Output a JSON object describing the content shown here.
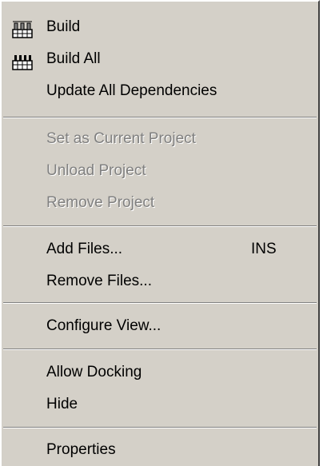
{
  "menu": {
    "items": {
      "build": {
        "label": "Build",
        "icon": "build-icon",
        "enabled": true
      },
      "build_all": {
        "label": "Build All",
        "icon": "build-all-icon",
        "enabled": true
      },
      "update_deps": {
        "label": "Update All Dependencies",
        "enabled": true
      },
      "set_current": {
        "label": "Set as Current Project",
        "enabled": false
      },
      "unload": {
        "label": "Unload Project",
        "enabled": false
      },
      "remove_project": {
        "label": "Remove Project",
        "enabled": false
      },
      "add_files": {
        "label": "Add Files...",
        "shortcut": "INS",
        "enabled": true
      },
      "remove_files": {
        "label": "Remove Files...",
        "enabled": true
      },
      "configure_view": {
        "label": "Configure View...",
        "enabled": true
      },
      "allow_docking": {
        "label": "Allow Docking",
        "enabled": true
      },
      "hide": {
        "label": "Hide",
        "enabled": true
      },
      "properties": {
        "label": "Properties",
        "enabled": true
      }
    }
  },
  "colors": {
    "menu_background": "#d4d0c8",
    "text": "#000000",
    "disabled_text": "#808080"
  }
}
